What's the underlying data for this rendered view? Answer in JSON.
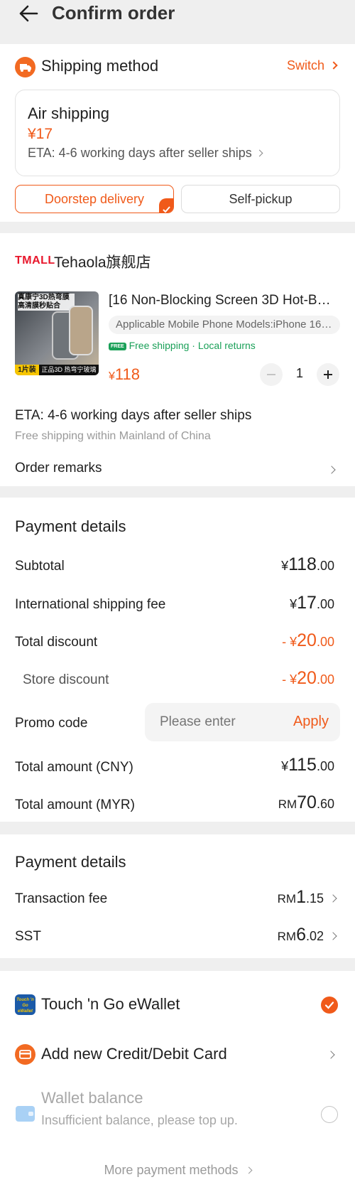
{
  "header": {
    "title": "Confirm order"
  },
  "shipping": {
    "title": "Shipping method",
    "switch_label": "Switch",
    "method_name": "Air shipping",
    "method_price": "¥17",
    "eta": "ETA: 4-6 working days after seller ships",
    "tab_doorstep": "Doorstep delivery",
    "tab_pickup": "Self-pickup"
  },
  "store": {
    "brand": "TMALL",
    "name": "Tehaola旗舰店",
    "product": {
      "title": "[16 Non-Blocking Screen 3D Hot-B…",
      "variant": "Applicable Mobile Phone Models:iPhone 16…",
      "free_badge": "FREE",
      "perks": "Free shipping · Local returns",
      "price_symbol": "¥",
      "price": "118",
      "quantity": "1",
      "image_text_top": "真康宁3D热弯膜\n高清膜秒贴合",
      "image_text_bottom_left": "1片装",
      "image_text_bottom_right": "正品3D 热弯宁玻璃"
    },
    "eta": "ETA: 4-6 working days after seller ships",
    "eta_note": "Free shipping within Mainland of China",
    "remarks_label": "Order remarks"
  },
  "payment": {
    "title": "Payment details",
    "subtotal_label": "Subtotal",
    "subtotal": {
      "cur": "¥",
      "int": "118",
      "dec": ".00"
    },
    "intl_label": "International shipping fee",
    "intl": {
      "cur": "¥",
      "int": "17",
      "dec": ".00"
    },
    "discount_label": "Total discount",
    "discount": {
      "cur": "- ¥",
      "int": "20",
      "dec": ".00"
    },
    "store_discount_label": "Store discount",
    "store_discount": {
      "cur": "- ¥",
      "int": "20",
      "dec": ".00"
    },
    "promo_label": "Promo code",
    "promo_placeholder": "Please enter",
    "promo_apply": "Apply",
    "total_cny_label": "Total amount (CNY)",
    "total_cny": {
      "cur": "¥",
      "int": "115",
      "dec": ".00"
    },
    "total_myr_label": "Total amount (MYR)",
    "total_myr": {
      "cur": "RM",
      "int": "70",
      "dec": ".60"
    }
  },
  "fees": {
    "title": "Payment details",
    "transaction_label": "Transaction fee",
    "transaction": {
      "cur": "RM",
      "int": "1",
      "dec": ".15"
    },
    "sst_label": "SST",
    "sst": {
      "cur": "RM",
      "int": "6",
      "dec": ".02"
    }
  },
  "methods": {
    "tng_logo_text": "Touch 'n Go eWallet",
    "tng_label": "Touch 'n Go eWallet",
    "card_label": "Add new Credit/Debit Card",
    "wallet_label": "Wallet balance",
    "wallet_note": "Insufficient balance, please top up.",
    "more_label": "More payment methods"
  },
  "colors": {
    "accent": "#f05a1a",
    "green": "#1aa058",
    "background": "#efefef",
    "tng_blue": "#1b5aa8"
  }
}
